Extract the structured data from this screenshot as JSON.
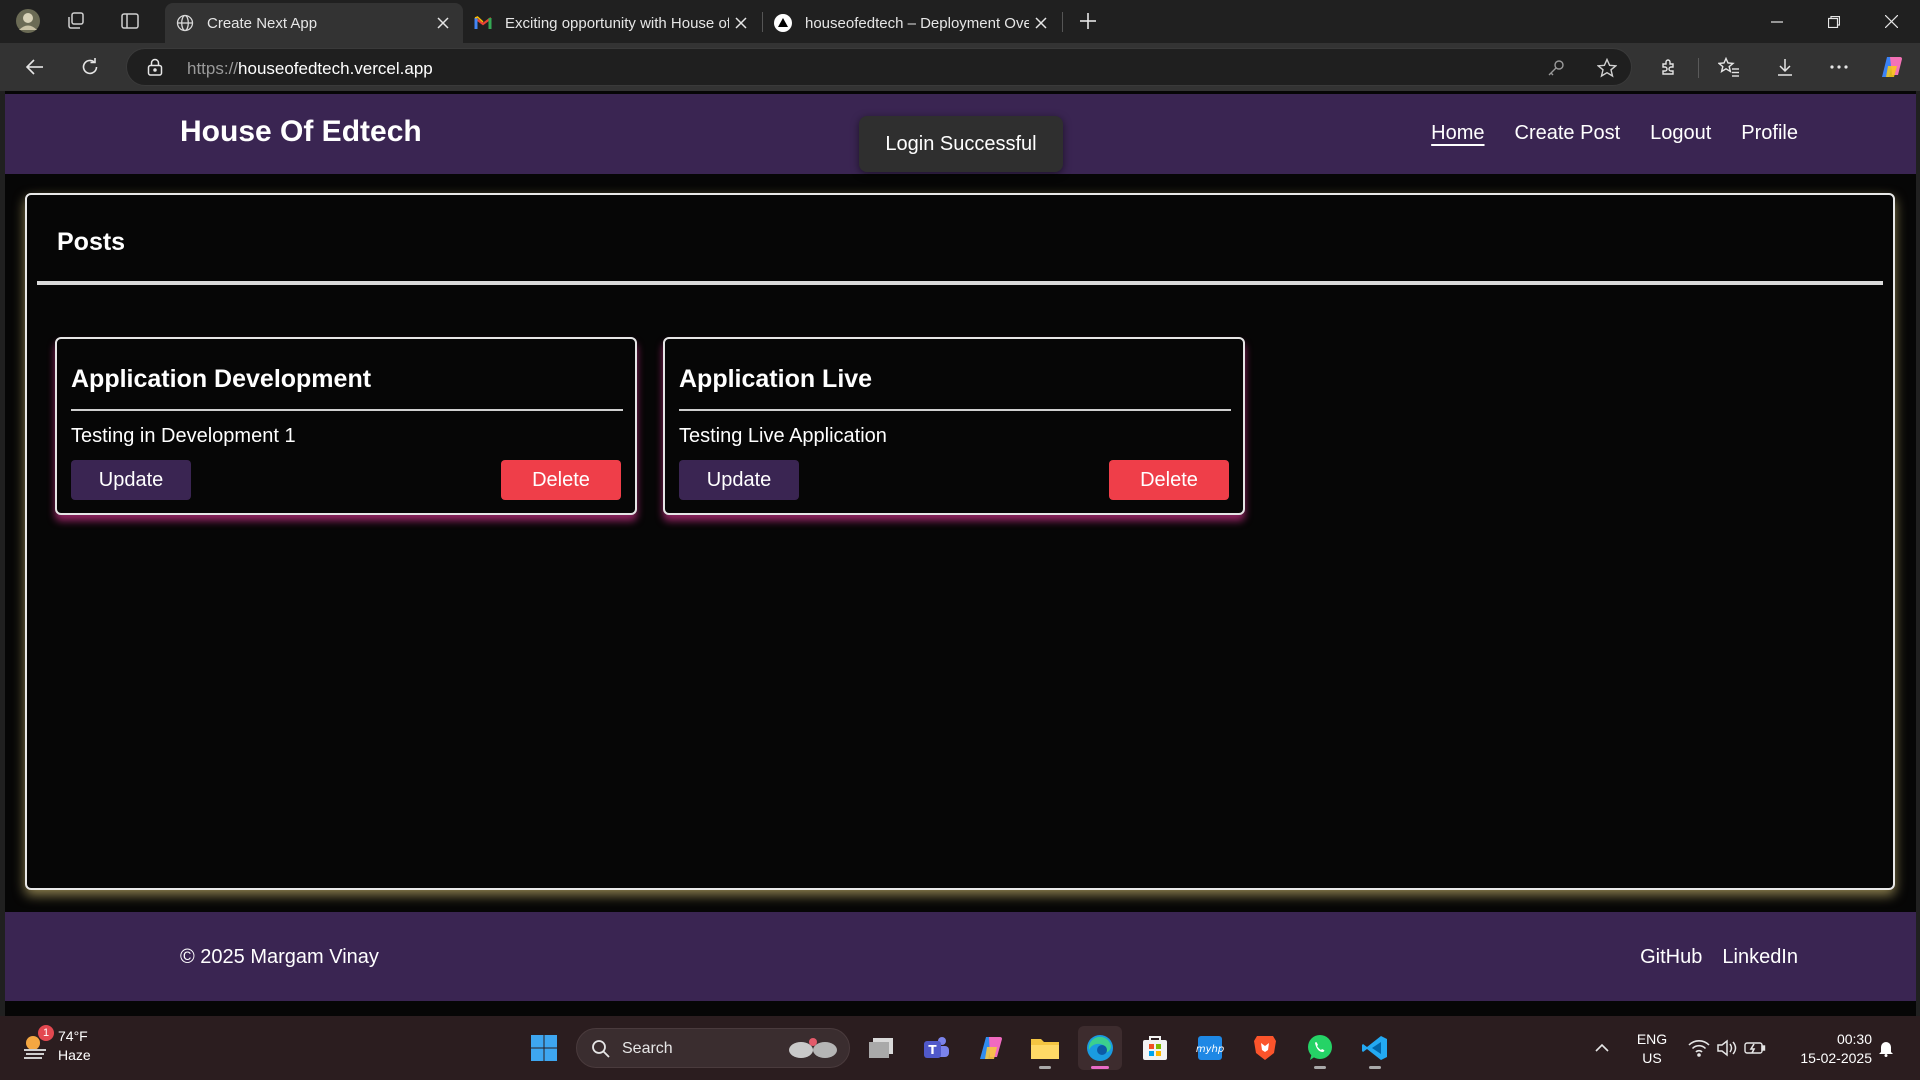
{
  "browser": {
    "tabs": [
      {
        "title": "Create Next App",
        "favicon": "globe-icon",
        "active": true
      },
      {
        "title": "Exciting opportunity with House of Edtech",
        "favicon": "gmail-icon",
        "active": false
      },
      {
        "title": "houseofedtech – Deployment Overview",
        "favicon": "vercel-icon",
        "active": false
      }
    ],
    "url_prefix": "https://",
    "url_domain": "houseofedtech.vercel.app"
  },
  "site": {
    "brand": "House Of Edtech",
    "toast": "Login Successful",
    "nav": [
      {
        "label": "Home",
        "active": true
      },
      {
        "label": "Create Post",
        "active": false
      },
      {
        "label": "Logout",
        "active": false
      },
      {
        "label": "Profile",
        "active": false
      }
    ],
    "posts_title": "Posts",
    "posts": [
      {
        "title": "Application Development",
        "description": "Testing in Development 1",
        "update_label": "Update",
        "delete_label": "Delete"
      },
      {
        "title": "Application Live",
        "description": "Testing Live Application",
        "update_label": "Update",
        "delete_label": "Delete"
      }
    ],
    "footer": {
      "copyright": "© 2025 Margam Vinay",
      "links": [
        "GitHub",
        "LinkedIn"
      ]
    },
    "colors": {
      "brand_purple": "#3a2552",
      "delete_red": "#ef3e49"
    }
  },
  "taskbar": {
    "weather_temp": "74°F",
    "weather_desc": "Haze",
    "weather_badge": "1",
    "search_label": "Search",
    "lang_top": "ENG",
    "lang_bottom": "US",
    "time": "00:30",
    "date": "15-02-2025"
  }
}
